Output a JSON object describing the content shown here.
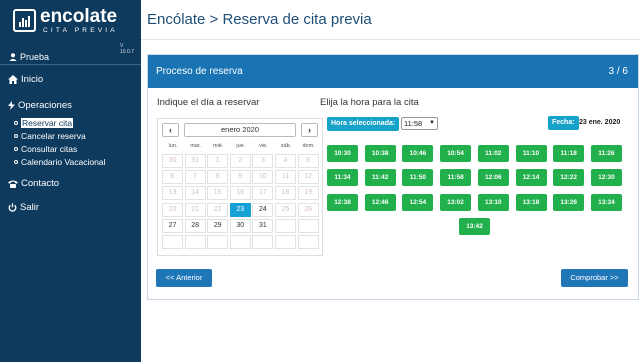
{
  "logo": {
    "text": "encolate",
    "sub": "CITA PREVIA",
    "version": "V 10.0.7"
  },
  "sidebar": {
    "user": "Prueba",
    "inicio": "Inicio",
    "operaciones": "Operaciones",
    "sub_items": [
      {
        "label": "Reservar cita",
        "active": true
      },
      {
        "label": "Cancelar reserva",
        "active": false
      },
      {
        "label": "Consultar citas",
        "active": false
      },
      {
        "label": "Calendario Vacacional",
        "active": false
      }
    ],
    "contacto": "Contacto",
    "salir": "Salir"
  },
  "header": {
    "title": "Encólate > Reserva de cita previa"
  },
  "panel": {
    "title": "Proceso de reserva",
    "step": "3 / 6",
    "day_label": "Indique el día a reservar",
    "time_label": "Elija la hora para la cita"
  },
  "calendar": {
    "month": "enero 2020",
    "prev": "‹",
    "next": "›",
    "weekdays": [
      "lun.",
      "mar.",
      "mié.",
      "jue.",
      "vie.",
      "sáb.",
      "dom."
    ],
    "weeks": [
      [
        {
          "d": "30",
          "s": "dis"
        },
        {
          "d": "31",
          "s": "dis"
        },
        {
          "d": "1",
          "s": "dis"
        },
        {
          "d": "2",
          "s": "dis"
        },
        {
          "d": "3",
          "s": "dis"
        },
        {
          "d": "4",
          "s": "dis"
        },
        {
          "d": "5",
          "s": "dis"
        }
      ],
      [
        {
          "d": "6",
          "s": "dis"
        },
        {
          "d": "7",
          "s": "dis"
        },
        {
          "d": "8",
          "s": "dis"
        },
        {
          "d": "9",
          "s": "dis"
        },
        {
          "d": "10",
          "s": "dis"
        },
        {
          "d": "11",
          "s": "dis"
        },
        {
          "d": "12",
          "s": "dis"
        }
      ],
      [
        {
          "d": "13",
          "s": "dis"
        },
        {
          "d": "14",
          "s": "dis"
        },
        {
          "d": "15",
          "s": "dis"
        },
        {
          "d": "16",
          "s": "dis"
        },
        {
          "d": "17",
          "s": "dis"
        },
        {
          "d": "18",
          "s": "dis"
        },
        {
          "d": "19",
          "s": "dis"
        }
      ],
      [
        {
          "d": "20",
          "s": "dis"
        },
        {
          "d": "21",
          "s": "dis"
        },
        {
          "d": "22",
          "s": "dis"
        },
        {
          "d": "23",
          "s": "sel"
        },
        {
          "d": "24",
          "s": "en"
        },
        {
          "d": "25",
          "s": "dis"
        },
        {
          "d": "26",
          "s": "dis"
        }
      ],
      [
        {
          "d": "27",
          "s": "en"
        },
        {
          "d": "28",
          "s": "en"
        },
        {
          "d": "29",
          "s": "en"
        },
        {
          "d": "30",
          "s": "en"
        },
        {
          "d": "31",
          "s": "en"
        },
        {
          "d": "",
          "s": "empty"
        },
        {
          "d": "",
          "s": "empty"
        }
      ],
      [
        {
          "d": "",
          "s": "empty"
        },
        {
          "d": "",
          "s": "empty"
        },
        {
          "d": "",
          "s": "empty"
        },
        {
          "d": "",
          "s": "empty"
        },
        {
          "d": "",
          "s": "empty"
        },
        {
          "d": "",
          "s": "empty"
        },
        {
          "d": "",
          "s": "empty"
        }
      ]
    ]
  },
  "time": {
    "selected_label": "Hora seleccionada:",
    "selected_value": "11:58",
    "date_label": "Fecha:",
    "date_value": "23 ene. 2020",
    "slots": [
      "10:30",
      "10:38",
      "10:46",
      "10:54",
      "11:02",
      "11:10",
      "11:18",
      "11:26",
      "11:34",
      "11:42",
      "11:50",
      "11:58",
      "12:06",
      "12:14",
      "12:22",
      "12:30",
      "12:38",
      "12:46",
      "12:54",
      "13:02",
      "13:10",
      "13:18",
      "13:26",
      "13:34",
      "13:42"
    ]
  },
  "buttons": {
    "prev": "<< Anterior",
    "next": "Comprobar >>"
  },
  "colors": {
    "sidebar": "#0e3a5e",
    "panel_header": "#1a74b4",
    "slot": "#21b04b",
    "selected_day": "#17a2d6"
  }
}
